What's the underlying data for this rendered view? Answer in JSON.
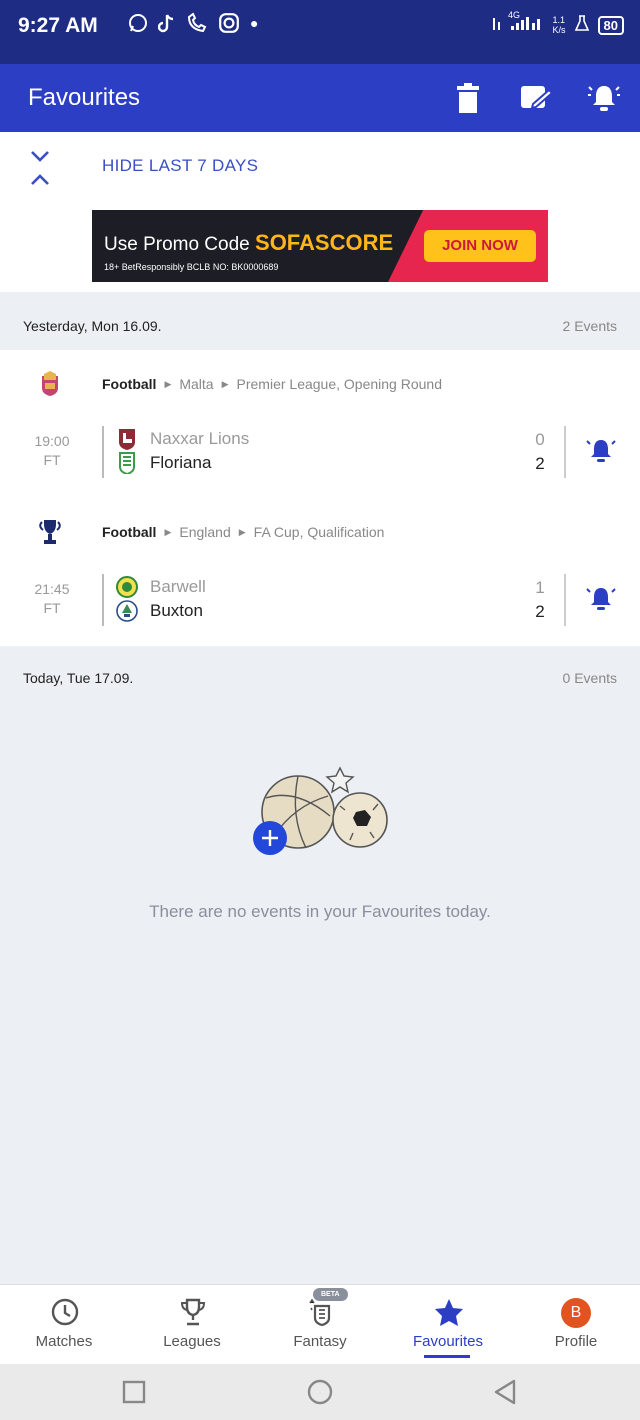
{
  "status_bar": {
    "time": "9:27 AM",
    "network": "4G",
    "speed": "1.1\nK/s",
    "battery": "80"
  },
  "app_bar": {
    "title": "Favourites",
    "actions": [
      "delete-icon",
      "edit-icon",
      "bell-icon"
    ]
  },
  "filter": {
    "label": "HIDE LAST 7 DAYS"
  },
  "ad": {
    "promo_prefix": "Use Promo Code ",
    "promo_code": "SOFASCORE",
    "small_print": "18+ BetResponsibly   BCLB NO: BK0000689",
    "cta": "JOIN NOW"
  },
  "days": [
    {
      "date": "Yesterday, Mon 16.09.",
      "count": "2 Events",
      "groups": [
        {
          "sport": "Football",
          "country": "Malta",
          "league": "Premier League, Opening Round",
          "match": {
            "time": "19:00",
            "status": "FT",
            "home": "Naxxar Lions",
            "away": "Floriana",
            "home_score": "0",
            "away_score": "2"
          }
        },
        {
          "sport": "Football",
          "country": "England",
          "league": "FA Cup, Qualification",
          "match": {
            "time": "21:45",
            "status": "FT",
            "home": "Barwell",
            "away": "Buxton",
            "home_score": "1",
            "away_score": "2"
          }
        }
      ]
    },
    {
      "date": "Today, Tue 17.09.",
      "count": "0 Events",
      "empty_message": "There are no events in your Favourites today."
    }
  ],
  "bottom_nav": [
    {
      "label": "Matches",
      "icon": "clock-icon"
    },
    {
      "label": "Leagues",
      "icon": "trophy-icon"
    },
    {
      "label": "Fantasy",
      "icon": "fantasy-icon",
      "badge": "BETA"
    },
    {
      "label": "Favourites",
      "icon": "star-icon",
      "active": true
    },
    {
      "label": "Profile",
      "icon": "avatar",
      "avatar_letter": "B"
    }
  ],
  "colors": {
    "status_bar": "#1f2c83",
    "app_bar": "#2c3ec4",
    "accent": "#2c3ec4",
    "background": "#eceff4"
  }
}
